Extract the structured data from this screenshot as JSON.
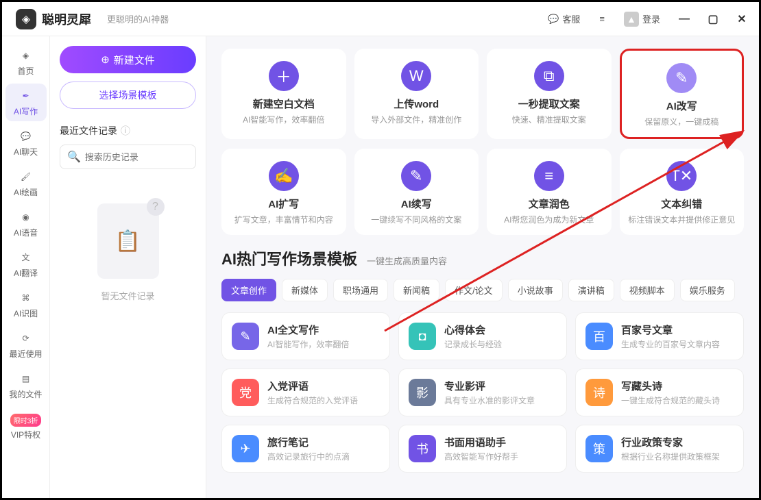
{
  "titlebar": {
    "app_name": "聪明灵犀",
    "tagline": "更聪明的AI神器",
    "support": "客服",
    "login": "登录"
  },
  "sidebar": {
    "items": [
      {
        "label": "首页",
        "icon": "home"
      },
      {
        "label": "AI写作",
        "icon": "feather"
      },
      {
        "label": "AI聊天",
        "icon": "chat"
      },
      {
        "label": "AI绘画",
        "icon": "brush"
      },
      {
        "label": "AI语音",
        "icon": "audio"
      },
      {
        "label": "AI翻译",
        "icon": "translate"
      },
      {
        "label": "AI识图",
        "icon": "scan"
      },
      {
        "label": "最近使用",
        "icon": "clock"
      },
      {
        "label": "我的文件",
        "icon": "file"
      },
      {
        "label": "VIP特权",
        "icon": "vip",
        "badge": "限时3折"
      }
    ]
  },
  "panel": {
    "new_file": "新建文件",
    "choose_template": "选择场景模板",
    "recent_label": "最近文件记录",
    "search_placeholder": "搜索历史记录",
    "empty_text": "暂无文件记录"
  },
  "features_row1": [
    {
      "title": "新建空白文档",
      "sub": "AI智能写作，效率翻倍",
      "color": "#7153e5",
      "glyph": "＋"
    },
    {
      "title": "上传word",
      "sub": "导入外部文件，精准创作",
      "color": "#7153e5",
      "glyph": "W"
    },
    {
      "title": "一秒提取文案",
      "sub": "快速、精准提取文案",
      "color": "#7153e5",
      "glyph": "⧉"
    },
    {
      "title": "AI改写",
      "sub": "保留原义，一键成稿",
      "color": "#a08bf5",
      "glyph": "✎",
      "highlight": true
    }
  ],
  "features_row2": [
    {
      "title": "AI扩写",
      "sub": "扩写文章，丰富情节和内容",
      "color": "#7153e5",
      "glyph": "✍"
    },
    {
      "title": "AI续写",
      "sub": "一键续写不同风格的文案",
      "color": "#7153e5",
      "glyph": "✎"
    },
    {
      "title": "文章润色",
      "sub": "AI帮您润色为成为新文章",
      "color": "#7153e5",
      "glyph": "≡"
    },
    {
      "title": "文本纠错",
      "sub": "标注错误文本并提供修正意见",
      "color": "#7153e5",
      "glyph": "T✕"
    }
  ],
  "section": {
    "title": "AI热门写作场景模板",
    "sub": "一键生成高质量内容"
  },
  "tabs": [
    "文章创作",
    "新媒体",
    "职场通用",
    "新闻稿",
    "作文/论文",
    "小说故事",
    "演讲稿",
    "视频脚本",
    "娱乐服务"
  ],
  "scenes": [
    {
      "title": "AI全文写作",
      "sub": "AI智能写作，效率翻倍",
      "color": "#7766e8",
      "glyph": "✎"
    },
    {
      "title": "心得体会",
      "sub": "记录成长与经验",
      "color": "#35c3b8",
      "glyph": "◘"
    },
    {
      "title": "百家号文章",
      "sub": "生成专业的百家号文章内容",
      "color": "#4a8cff",
      "glyph": "百"
    },
    {
      "title": "入党评语",
      "sub": "生成符合规范的入党评语",
      "color": "#ff5c5c",
      "glyph": "党"
    },
    {
      "title": "专业影评",
      "sub": "具有专业水准的影评文章",
      "color": "#6b7a99",
      "glyph": "影"
    },
    {
      "title": "写藏头诗",
      "sub": "一键生成符合规范的藏头诗",
      "color": "#ff9a3c",
      "glyph": "诗"
    },
    {
      "title": "旅行笔记",
      "sub": "高效记录旅行中的点滴",
      "color": "#4a8cff",
      "glyph": "✈"
    },
    {
      "title": "书面用语助手",
      "sub": "高效智能写作好帮手",
      "color": "#7153e5",
      "glyph": "书"
    },
    {
      "title": "行业政策专家",
      "sub": "根据行业名称提供政策框架",
      "color": "#4a8cff",
      "glyph": "策"
    }
  ]
}
